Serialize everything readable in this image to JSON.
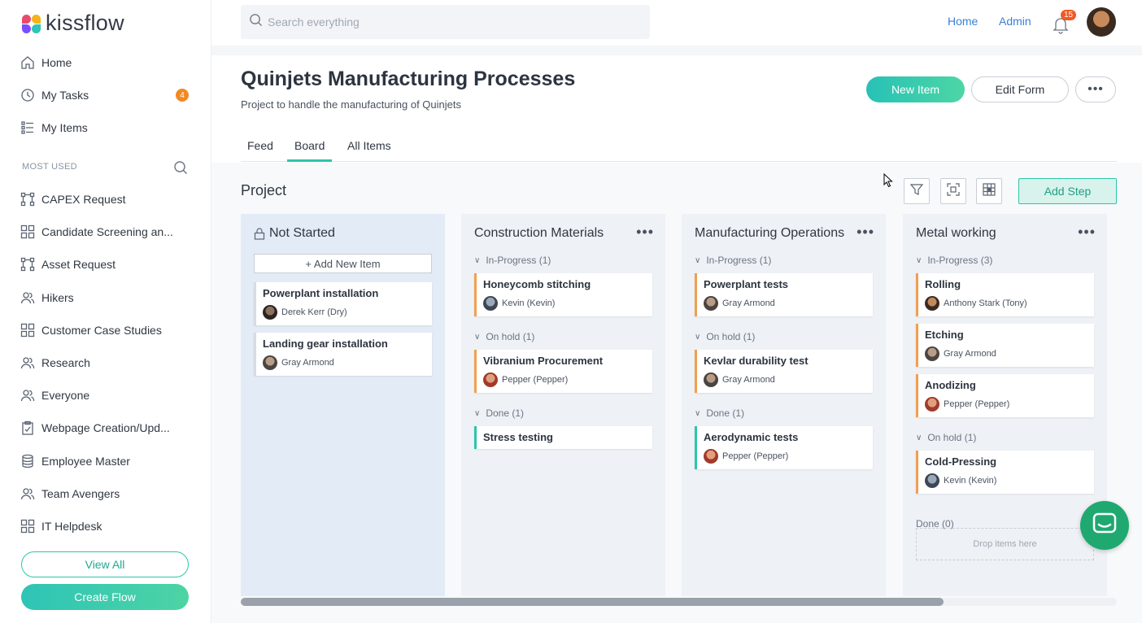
{
  "brand": {
    "name": "kissflow"
  },
  "sidebar": {
    "nav": [
      {
        "label": "Home",
        "icon": "home-icon"
      },
      {
        "label": "My Tasks",
        "icon": "clock-icon",
        "badge": "4"
      },
      {
        "label": "My Items",
        "icon": "list-icon"
      }
    ],
    "section_label": "MOST USED",
    "flows": [
      {
        "label": "CAPEX Request",
        "icon": "process-icon"
      },
      {
        "label": "Candidate Screening an...",
        "icon": "grid-icon"
      },
      {
        "label": "Asset Request",
        "icon": "process-icon"
      },
      {
        "label": "Hikers",
        "icon": "people-icon"
      },
      {
        "label": "Customer Case Studies",
        "icon": "grid-icon"
      },
      {
        "label": "Research",
        "icon": "people-icon"
      },
      {
        "label": "Everyone",
        "icon": "people-icon"
      },
      {
        "label": "Webpage Creation/Upd...",
        "icon": "clipboard-icon"
      },
      {
        "label": "Employee Master",
        "icon": "database-icon"
      },
      {
        "label": "Team Avengers",
        "icon": "people-icon"
      },
      {
        "label": "IT Helpdesk",
        "icon": "grid-icon"
      }
    ],
    "view_all": "View All",
    "create_flow": "Create Flow"
  },
  "topbar": {
    "search_placeholder": "Search everything",
    "links": [
      "Home",
      "Admin"
    ],
    "notification_count": "15"
  },
  "page": {
    "title": "Quinjets Manufacturing Processes",
    "subtitle": "Project to handle the manufacturing of Quinjets",
    "new_item": "New Item",
    "edit_form": "Edit Form",
    "more": "•••",
    "tabs": [
      "Feed",
      "Board",
      "All Items"
    ],
    "active_tab": "Board"
  },
  "board": {
    "label": "Project",
    "add_step": "Add Step",
    "columns": [
      {
        "title": "Not Started",
        "add_item": "+ Add New Item",
        "cards": [
          {
            "title": "Powerplant installation",
            "user": "Derek Kerr (Dry)"
          },
          {
            "title": "Landing gear installation",
            "user": "Gray Armond"
          }
        ]
      },
      {
        "title": "Construction Materials",
        "groups": [
          {
            "label": "In-Progress",
            "count": "(1)",
            "cards": [
              {
                "title": "Honeycomb stitching",
                "user": "Kevin (Kevin)"
              }
            ]
          },
          {
            "label": "On hold",
            "count": "(1)",
            "cards": [
              {
                "title": "Vibranium Procurement",
                "user": "Pepper (Pepper)"
              }
            ]
          },
          {
            "label": "Done",
            "count": "(1)",
            "cards": [
              {
                "title": "Stress testing",
                "user": ""
              }
            ]
          }
        ]
      },
      {
        "title": "Manufacturing Operations",
        "groups": [
          {
            "label": "In-Progress",
            "count": "(1)",
            "cards": [
              {
                "title": "Powerplant tests",
                "user": "Gray Armond"
              }
            ]
          },
          {
            "label": "On hold",
            "count": "(1)",
            "cards": [
              {
                "title": "Kevlar durability test",
                "user": "Gray Armond"
              }
            ]
          },
          {
            "label": "Done",
            "count": "(1)",
            "cards": [
              {
                "title": "Aerodynamic tests",
                "user": "Pepper (Pepper)"
              }
            ]
          }
        ]
      },
      {
        "title": "Metal working",
        "groups": [
          {
            "label": "In-Progress",
            "count": "(3)",
            "cards": [
              {
                "title": "Rolling",
                "user": "Anthony Stark (Tony)"
              },
              {
                "title": "Etching",
                "user": "Gray Armond"
              },
              {
                "title": "Anodizing",
                "user": "Pepper (Pepper)"
              }
            ]
          },
          {
            "label": "On hold",
            "count": "(1)",
            "cards": [
              {
                "title": "Cold-Pressing",
                "user": "Kevin (Kevin)"
              }
            ]
          },
          {
            "label": "Done",
            "count": "(0)",
            "cards": []
          }
        ],
        "drop_text": "Drop items here"
      }
    ]
  },
  "colors": {
    "accent": "#2cc5a8",
    "link": "#3a7fd5",
    "badge": "#f08a24",
    "on_hold": "#f0a050",
    "done": "#2cc5a8"
  }
}
